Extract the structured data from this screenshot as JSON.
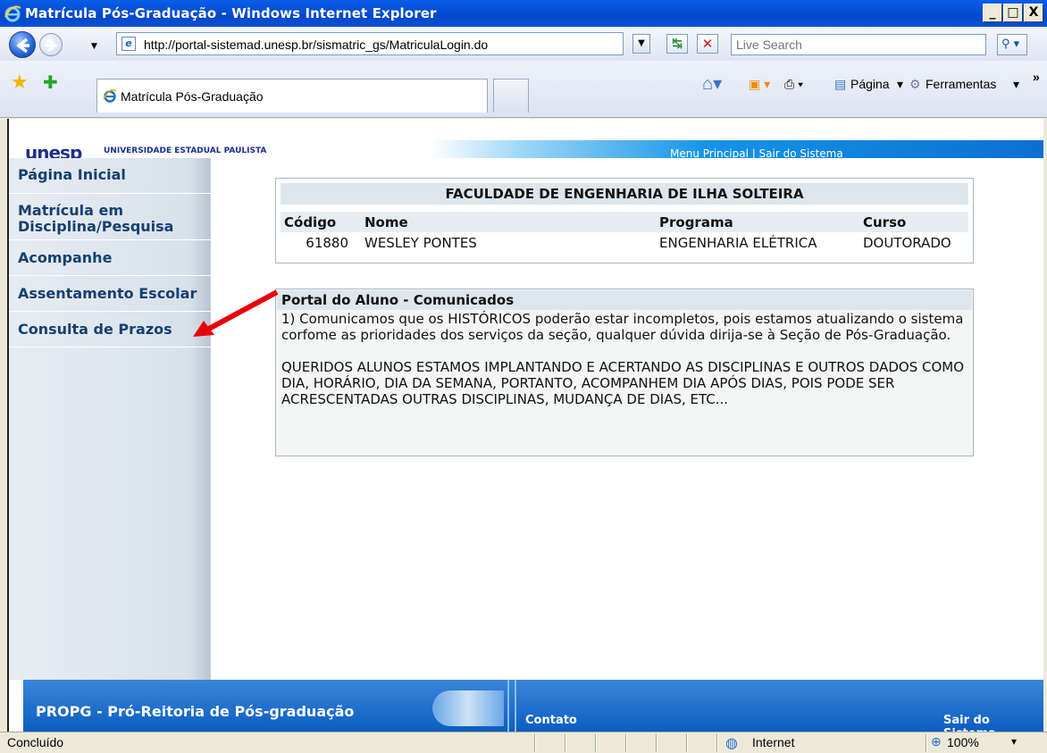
{
  "window": {
    "title": "Matrícula Pós-Graduação - Windows Internet Explorer",
    "min_label": "_",
    "max_label": "□",
    "close_label": "X"
  },
  "address": {
    "url": "http://portal-sistemad.unesp.br/sismatric_gs/MatriculaLogin.do",
    "search_placeholder": "Live Search"
  },
  "tab": {
    "title": "Matrícula Pós-Graduação"
  },
  "commands": {
    "page": "Página",
    "tools": "Ferramentas"
  },
  "header": {
    "logo": "unesp",
    "university": "UNIVERSIDADE ESTADUAL PAULISTA",
    "menu": "Menu Principal | Sair do Sistema"
  },
  "sidebar": {
    "items": [
      {
        "label": "Página Inicial"
      },
      {
        "label": "Matrícula em Disciplina/Pesquisa"
      },
      {
        "label": "Acompanhe"
      },
      {
        "label": "Assentamento Escolar"
      },
      {
        "label": "Consulta de Prazos"
      }
    ]
  },
  "student": {
    "faculty": "FACULDADE DE ENGENHARIA DE ILHA SOLTEIRA",
    "headers": [
      "Código",
      "Nome",
      "Programa",
      "Curso"
    ],
    "row": [
      "61880",
      "WESLEY PONTES",
      "ENGENHARIA ELÉTRICA",
      "DOUTORADO"
    ]
  },
  "notices": {
    "title": "Portal do Aluno - Comunicados",
    "p1": "1) Comunicamos que os HISTÓRICOS poderão estar incompletos, pois estamos atualizando o sistema corfome as prioridades dos serviços da seção, qualquer dúvida dirija-se à Seção de Pós-Graduação.",
    "p2": "QUERIDOS ALUNOS ESTAMOS IMPLANTANDO E ACERTANDO AS DISCIPLINAS E OUTROS DADOS COMO DIA, HORÁRIO, DIA DA SEMANA, PORTANTO, ACOMPANHEM DIA APÓS DIAS, POIS PODE SER ACRESCENTADAS OUTRAS DISCIPLINAS, MUDANÇA DE DIAS, ETC..."
  },
  "footer": {
    "title": "PROPG - Pró-Reitoria de Pós-graduação",
    "contact": "Contato",
    "logout": "Sair do Sistema"
  },
  "status": {
    "text": "Concluído",
    "zone": "Internet",
    "zoom": "100%"
  },
  "colors": {
    "title_bar": "#0a4fd6",
    "sidebar_text": "#15406f",
    "footer": "#0b5dc2",
    "arrow": "#e8000b"
  }
}
